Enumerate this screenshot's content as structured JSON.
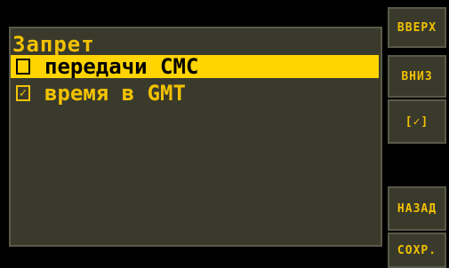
{
  "screen": {
    "title": "Запрет",
    "items": [
      {
        "label": "передачи СМС",
        "checked": false,
        "selected": true,
        "mark": ""
      },
      {
        "label": "время в GMT",
        "checked": true,
        "selected": false,
        "mark": "✓"
      }
    ]
  },
  "buttons": {
    "up": "ВВЕРХ",
    "down": "ВНИЗ",
    "toggle": "[✓]",
    "back": "НАЗАД",
    "save": "СОХР."
  },
  "colors": {
    "accent": "#f2c200",
    "highlight": "#ffd400",
    "panel": "#3a3a2c",
    "background": "#000000"
  }
}
